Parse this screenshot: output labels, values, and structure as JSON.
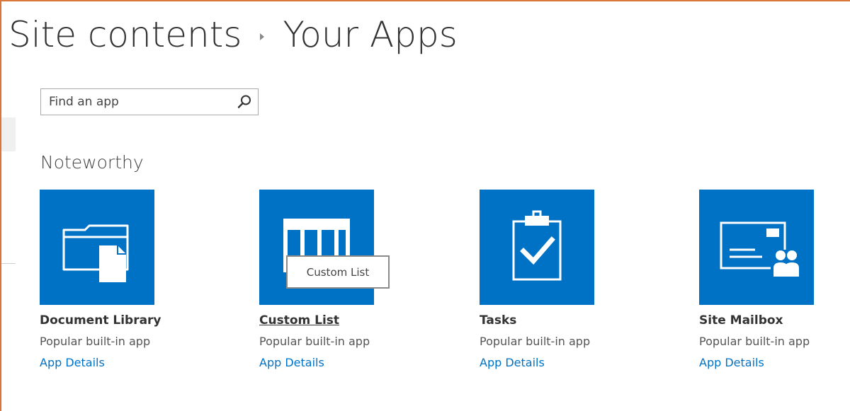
{
  "header": {
    "breadcrumb_root": "Site contents",
    "breadcrumb_current": "Your Apps"
  },
  "search": {
    "placeholder": "Find an app",
    "value": ""
  },
  "section": {
    "heading": "Noteworthy"
  },
  "apps": [
    {
      "name": "Document Library",
      "subtitle": "Popular built-in app",
      "details_link": "App Details",
      "icon": "document-library-icon"
    },
    {
      "name": "Custom List",
      "subtitle": "Popular built-in app",
      "details_link": "App Details",
      "icon": "custom-list-icon"
    },
    {
      "name": "Tasks",
      "subtitle": "Popular built-in app",
      "details_link": "App Details",
      "icon": "tasks-icon"
    },
    {
      "name": "Site Mailbox",
      "subtitle": "Popular built-in app",
      "details_link": "App Details",
      "icon": "site-mailbox-icon"
    }
  ],
  "tooltip": {
    "text": "Custom List"
  },
  "colors": {
    "tile_blue": "#0072c6",
    "frame_accent": "#d9773b",
    "link_blue": "#0072c6"
  }
}
